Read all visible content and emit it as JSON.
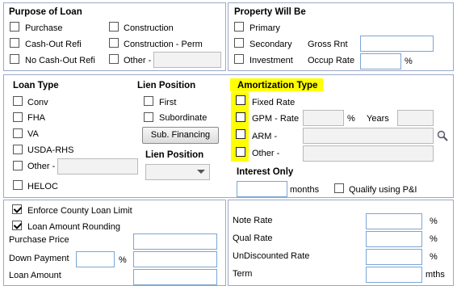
{
  "purpose": {
    "title": "Purpose of Loan",
    "items": [
      {
        "label": "Purchase",
        "checked": false
      },
      {
        "label": "Cash-Out Refi",
        "checked": false
      },
      {
        "label": "No Cash-Out Refi",
        "checked": false
      },
      {
        "label": "Construction",
        "checked": false
      },
      {
        "label": "Construction - Perm",
        "checked": false
      },
      {
        "label": "Other -",
        "checked": false
      }
    ],
    "other_value": ""
  },
  "property": {
    "title": "Property Will Be",
    "items": [
      {
        "label": "Primary",
        "checked": false
      },
      {
        "label": "Secondary",
        "checked": false
      },
      {
        "label": "Investment",
        "checked": false
      }
    ],
    "gross_rnt_label": "Gross Rnt",
    "gross_rnt_value": "",
    "occup_rate_label": "Occup Rate",
    "occup_rate_value": "",
    "percent": "%"
  },
  "loan_type": {
    "title": "Loan Type",
    "items": [
      {
        "label": "Conv",
        "checked": false
      },
      {
        "label": "FHA",
        "checked": false
      },
      {
        "label": "VA",
        "checked": false
      },
      {
        "label": "USDA-RHS",
        "checked": false
      },
      {
        "label": "Other -",
        "checked": false
      },
      {
        "label": "HELOC",
        "checked": false
      }
    ],
    "other_value": ""
  },
  "lien": {
    "title": "Lien Position",
    "items": [
      {
        "label": "First",
        "checked": false
      },
      {
        "label": "Subordinate",
        "checked": false
      }
    ],
    "sub_financing_button": "Sub. Financing",
    "dropdown_title": "Lien Position",
    "dropdown_value": ""
  },
  "amortization": {
    "title": "Amortization Type",
    "items": [
      {
        "label": "Fixed Rate",
        "checked": false
      },
      {
        "label": "GPM - Rate",
        "checked": false
      },
      {
        "label": "ARM -",
        "checked": false
      },
      {
        "label": "Other -",
        "checked": false
      }
    ],
    "gpm_rate_value": "",
    "percent": "%",
    "years_label": "Years",
    "years_value": "",
    "arm_value": "",
    "other_value": "",
    "highlight_color": "#ffff00"
  },
  "interest_only": {
    "title": "Interest Only",
    "months_value": "",
    "months_label": "months",
    "qualify_label": "Qualify using P&I",
    "qualify_checked": false
  },
  "loan_amount": {
    "enforce_label": "Enforce County Loan Limit",
    "enforce_checked": true,
    "rounding_label": "Loan Amount Rounding",
    "rounding_checked": true,
    "purchase_price_label": "Purchase Price",
    "purchase_price_value": "",
    "down_payment_label": "Down Payment",
    "down_payment_pct": "",
    "percent": "%",
    "down_payment_value": "",
    "loan_amount_label": "Loan Amount",
    "loan_amount_value": ""
  },
  "rates": {
    "note_rate_label": "Note Rate",
    "note_rate_value": "",
    "qual_rate_label": "Qual Rate",
    "qual_rate_value": "",
    "undiscounted_label": "UnDiscounted Rate",
    "undiscounted_value": "",
    "term_label": "Term",
    "term_value": "",
    "percent": "%",
    "mths": "mths"
  },
  "icons": {
    "search": "magnifier-icon",
    "dropdown": "chevron-down-icon"
  }
}
